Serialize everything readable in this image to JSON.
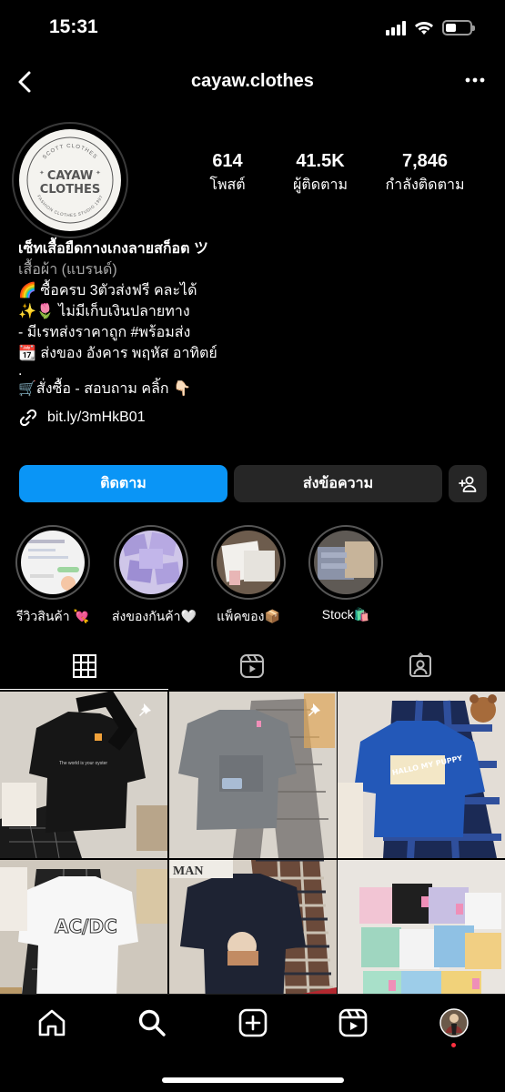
{
  "status": {
    "time": "15:31"
  },
  "header": {
    "username": "cayaw.clothes"
  },
  "profile": {
    "logo_main": "CAYAW CLOTHES",
    "logo_top": "SCOTT CLOTHES",
    "logo_bottom": "FASHION CLOTHES STUDIO 1997",
    "stats": [
      {
        "num": "614",
        "label": "โพสต์"
      },
      {
        "num": "41.5K",
        "label": "ผู้ติดตาม"
      },
      {
        "num": "7,846",
        "label": "กำลังติดตาม"
      }
    ],
    "name": "เซ็ทเสื้อยืดกางเกงลายสก็อต  ツ",
    "category": "เสื้อผ้า (แบรนด์)",
    "bio_lines": [
      "🌈 ซื้อครบ 3ตัวส่งฟรี คละได้",
      "✨🌷 ไม่มีเก็บเงินปลายทาง",
      "- มีเรทส่งราคาถูก #พร้อมส่ง",
      "📆 ส่งของ อังคาร พฤหัส อาทิตย์",
      ".",
      "🛒สั่งซื้อ - สอบถาม คลิ้ก 👇🏻"
    ],
    "link": "bit.ly/3mHkB01"
  },
  "actions": {
    "follow": "ติดตาม",
    "message": "ส่งข้อความ"
  },
  "highlights": [
    {
      "label": "รีวิวสินค้า 💘"
    },
    {
      "label": "ส่งของกันค้า🤍"
    },
    {
      "label": "แพ็คของ📦"
    },
    {
      "label": "Stock🛍️"
    }
  ],
  "icons": {
    "back": "back-arrow-icon",
    "more": "more-dots-icon",
    "grid": "grid-icon",
    "reels": "reels-icon",
    "tagged": "tagged-icon",
    "home": "home-icon",
    "search": "search-icon",
    "create": "create-icon",
    "profile": "profile-avatar"
  },
  "colors": {
    "accent": "#0a95f6",
    "dark_button": "#262626",
    "background": "#000000"
  }
}
